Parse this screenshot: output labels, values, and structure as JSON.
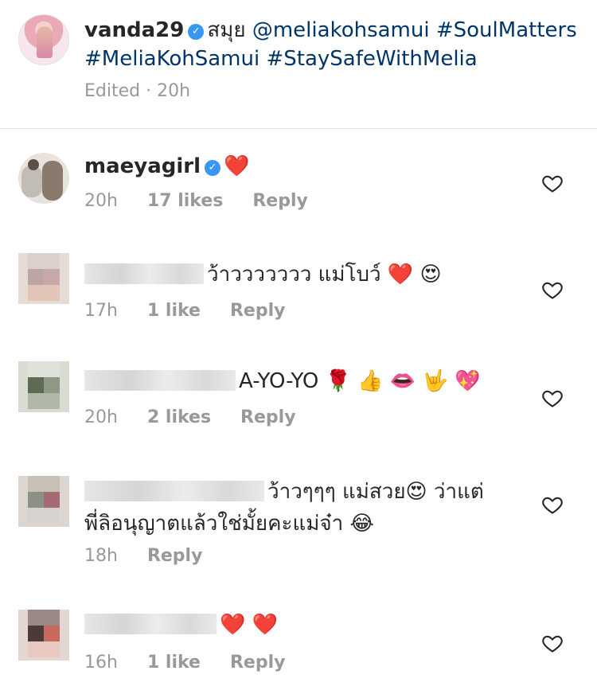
{
  "caption": {
    "username": "vanda29",
    "text": "สมุย",
    "mention": "@meliakohsamui",
    "tags": [
      "#SoulMatters",
      "#MeliaKohSamui",
      "#StaySafeWithMelia"
    ],
    "edited": "Edited · 20h"
  },
  "comments": [
    {
      "username": "maeyagirl",
      "text": "❤️",
      "time": "20h",
      "likes": "17 likes",
      "reply": "Reply"
    },
    {
      "username": "",
      "text": "ว้าววววววว แม่โบว์ ❤️ 😍",
      "time": "17h",
      "likes": "1 like",
      "reply": "Reply"
    },
    {
      "username": "",
      "text": "A-YO-YO 🌹 👍 👄 🤟 💖",
      "time": "20h",
      "likes": "2 likes",
      "reply": "Reply"
    },
    {
      "username": "",
      "text": "ว้าวๆๆๆ แม่สวย😍 ว่าแต่",
      "text2": "พี่ลิอนุญาตแล้วใช่มั้ยคะแม่จ๋า 😂",
      "time": "18h",
      "likes": "",
      "reply": "Reply"
    },
    {
      "username": "",
      "text": "❤️ ❤️",
      "time": "16h",
      "likes": "1 like",
      "reply": "Reply"
    }
  ],
  "icons": {
    "verified": "verified-badge-icon",
    "like": "heart-outline-icon"
  },
  "colors": {
    "link": "#003569",
    "verified": "#3897f0",
    "meta": "#999999"
  }
}
